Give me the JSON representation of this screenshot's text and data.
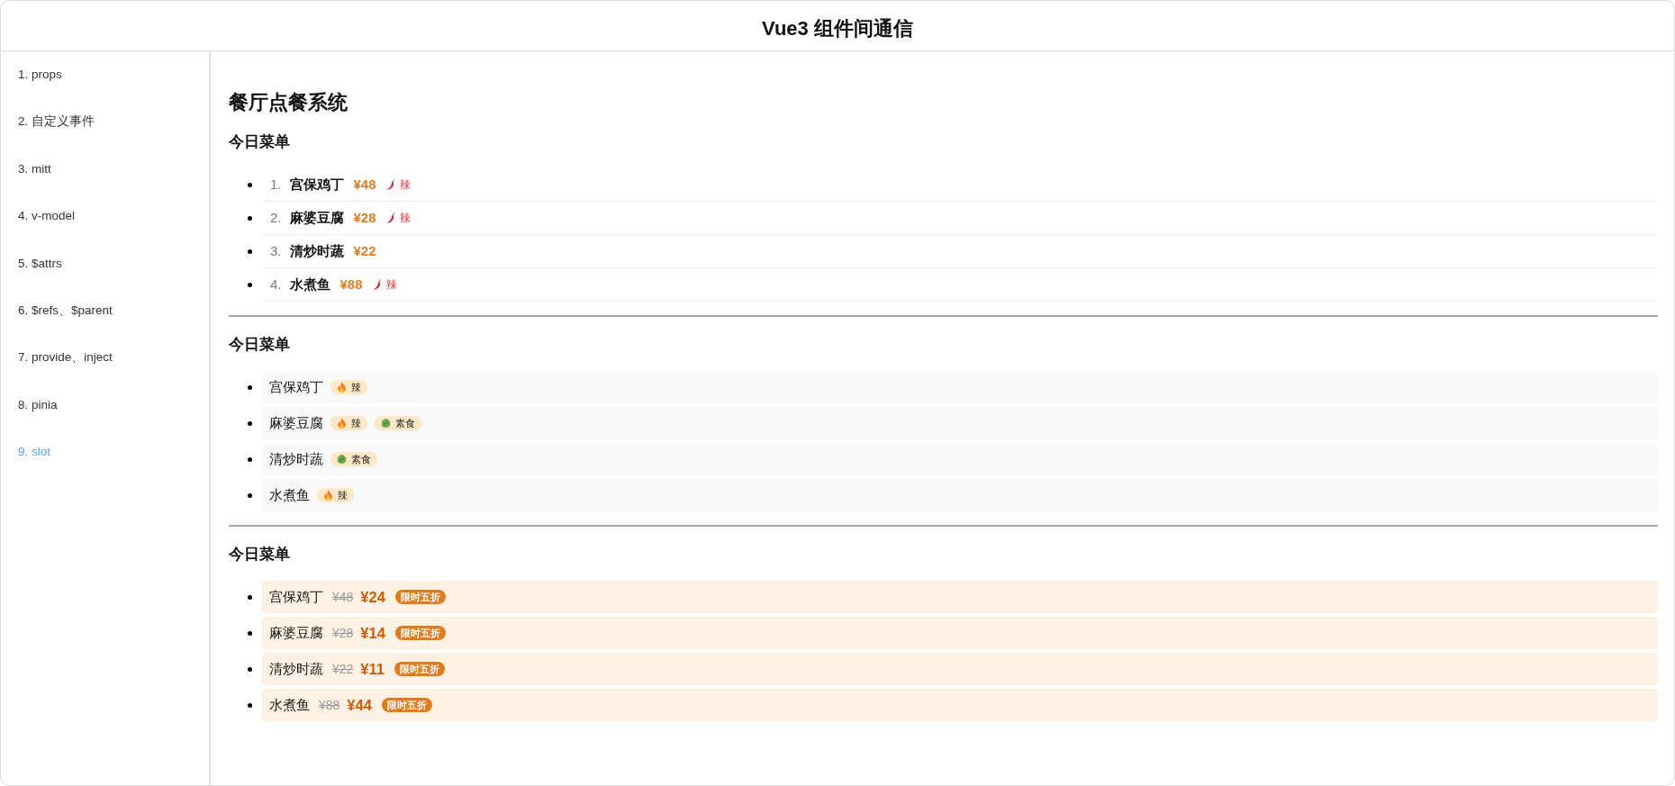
{
  "header": {
    "title": "Vue3 组件间通信"
  },
  "sidebar": {
    "items": [
      {
        "label": "1. props",
        "selected": false
      },
      {
        "label": "2. 自定义事件",
        "selected": false
      },
      {
        "label": "3. mitt",
        "selected": false
      },
      {
        "label": "4. v-model",
        "selected": false
      },
      {
        "label": "5. $attrs",
        "selected": false
      },
      {
        "label": "6. $refs、$parent",
        "selected": false
      },
      {
        "label": "7. provide、inject",
        "selected": false
      },
      {
        "label": "8. pinia",
        "selected": false
      },
      {
        "label": "9. slot",
        "selected": true
      }
    ]
  },
  "content": {
    "title": "餐厅点餐系统",
    "sections": [
      {
        "kind": "numbered",
        "heading": "今日菜单",
        "items": [
          {
            "index": "1.",
            "name": "宫保鸡丁",
            "price": "¥48",
            "tag": {
              "kind": "spicy",
              "label": "辣"
            }
          },
          {
            "index": "2.",
            "name": "麻婆豆腐",
            "price": "¥28",
            "tag": {
              "kind": "spicy",
              "label": "辣"
            }
          },
          {
            "index": "3.",
            "name": "清炒时蔬",
            "price": "¥22"
          },
          {
            "index": "4.",
            "name": "水煮鱼",
            "price": "¥88",
            "tag": {
              "kind": "spicy",
              "label": "辣"
            }
          }
        ]
      },
      {
        "kind": "tagged",
        "heading": "今日菜单",
        "items": [
          {
            "name": "宫保鸡丁",
            "tags": [
              {
                "kind": "spicy",
                "label": "辣"
              }
            ]
          },
          {
            "name": "麻婆豆腐",
            "tags": [
              {
                "kind": "spicy",
                "label": "辣"
              },
              {
                "kind": "vegetarian",
                "label": "素食"
              }
            ]
          },
          {
            "name": "清炒时蔬",
            "tags": [
              {
                "kind": "vegetarian",
                "label": "素食"
              }
            ]
          },
          {
            "name": "水煮鱼",
            "tags": [
              {
                "kind": "spicy",
                "label": "辣"
              }
            ]
          }
        ]
      },
      {
        "kind": "discount",
        "heading": "今日菜单",
        "items": [
          {
            "name": "宫保鸡丁",
            "old_price": "¥48",
            "price": "¥24",
            "badge": "限时五折"
          },
          {
            "name": "麻婆豆腐",
            "old_price": "¥28",
            "price": "¥14",
            "badge": "限时五折"
          },
          {
            "name": "清炒时蔬",
            "old_price": "¥22",
            "price": "¥11",
            "badge": "限时五折"
          },
          {
            "name": "水煮鱼",
            "old_price": "¥88",
            "price": "¥44",
            "badge": "限时五折"
          }
        ]
      }
    ]
  }
}
